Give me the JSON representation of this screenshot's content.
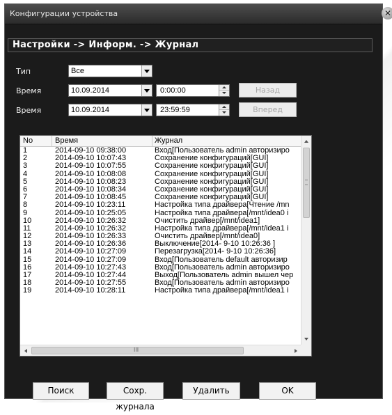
{
  "window": {
    "title": "Конфигурации устройства"
  },
  "breadcrumb": "Настройки -> Информ. -> Журнал",
  "filters": {
    "type_label": "Тип",
    "type_value": "Все",
    "time_label_1": "Время",
    "date_1": "10.09.2014",
    "time_1": "0:00:00",
    "back_label": "Назад",
    "time_label_2": "Время",
    "date_2": "10.09.2014",
    "time_2": "23:59:59",
    "forward_label": "Вперед"
  },
  "log": {
    "columns": [
      "No",
      "Время",
      "Журнал"
    ],
    "rows": [
      {
        "no": "1",
        "time": "2014-09-10 09:38:00",
        "entry": "Вход[Пользователь admin авторизиро"
      },
      {
        "no": "2",
        "time": "2014-09-10 10:07:43",
        "entry": "Сохранение конфигураций[GUI]"
      },
      {
        "no": "3",
        "time": "2014-09-10 10:07:55",
        "entry": "Сохранение конфигураций[GUI]"
      },
      {
        "no": "4",
        "time": "2014-09-10 10:08:08",
        "entry": "Сохранение конфигураций[GUI]"
      },
      {
        "no": "5",
        "time": "2014-09-10 10:08:23",
        "entry": "Сохранение конфигураций[GUI]"
      },
      {
        "no": "6",
        "time": "2014-09-10 10:08:34",
        "entry": "Сохранение конфигураций[GUI]"
      },
      {
        "no": "7",
        "time": "2014-09-10 10:08:45",
        "entry": "Сохранение конфигураций[GUI]"
      },
      {
        "no": "8",
        "time": "2014-09-10 10:23:11",
        "entry": "Настройка типа драйвера[Чтение /mn"
      },
      {
        "no": "9",
        "time": "2014-09-10 10:25:05",
        "entry": "Настройка типа драйвера[/mnt/idea0 i"
      },
      {
        "no": "10",
        "time": "2014-09-10 10:26:32",
        "entry": "Очистить драйвер[/mnt/idea1]"
      },
      {
        "no": "11",
        "time": "2014-09-10 10:26:32",
        "entry": "Настройка типа драйвера[/mnt/idea1 i"
      },
      {
        "no": "12",
        "time": "2014-09-10 10:26:33",
        "entry": "Очистить драйвер[/mnt/idea0]"
      },
      {
        "no": "13",
        "time": "2014-09-10 10:26:36",
        "entry": "Выключение[2014- 9-10 10:26:36 ]"
      },
      {
        "no": "14",
        "time": "2014-09-10 10:27:09",
        "entry": "Перезагрузка[2014- 9-10 10:26:36]"
      },
      {
        "no": "15",
        "time": "2014-09-10 10:27:09",
        "entry": "Вход[Пользователь default авторизир"
      },
      {
        "no": "16",
        "time": "2014-09-10 10:27:43",
        "entry": "Вход[Пользователь admin авторизиро"
      },
      {
        "no": "17",
        "time": "2014-09-10 10:27:44",
        "entry": "Выход[Пользователь admin вышел чер"
      },
      {
        "no": "18",
        "time": "2014-09-10 10:27:55",
        "entry": "Вход[Пользователь admin авторизиро"
      },
      {
        "no": "19",
        "time": "2014-09-10 10:28:11",
        "entry": "Настройка типа драйвера[/mnt/idea1 i"
      }
    ]
  },
  "hscroll_grip": "III",
  "buttons": {
    "search": "Поиск",
    "save_log": "Сохр. журнала",
    "delete": "Удалить",
    "ok": "OK"
  }
}
